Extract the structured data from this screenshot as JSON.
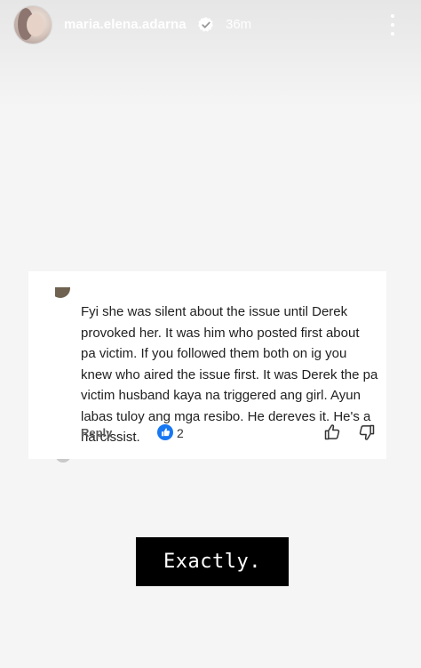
{
  "story": {
    "username": "maria.elena.adarna",
    "time": "36m",
    "verified_icon": "verified-badge-icon",
    "more_icon": "more-vertical-icon"
  },
  "comment": {
    "lines": [
      "Fyi she was silent about the issue until Derek",
      "provoked her. It was him who posted first about",
      "pa victim. If you followed them both on ig you",
      "knew who aired the issue first. It was Derek the pa",
      "victim husband kaya na triggered ang girl. Ayun",
      "labas tuloy ang mga resibo. He dereves it. He's a",
      "narcissist."
    ],
    "reply_label": "Reply",
    "like_count": "2",
    "like_icon": "like-badge-icon",
    "thumb_up_icon": "thumb-up-icon",
    "thumb_down_icon": "thumb-down-icon"
  },
  "caption": {
    "text": "Exactly."
  },
  "colors": {
    "background": "#f5f5f5",
    "card": "#ffffff",
    "like_blue": "#1877f2",
    "caption_bg": "#000000"
  }
}
